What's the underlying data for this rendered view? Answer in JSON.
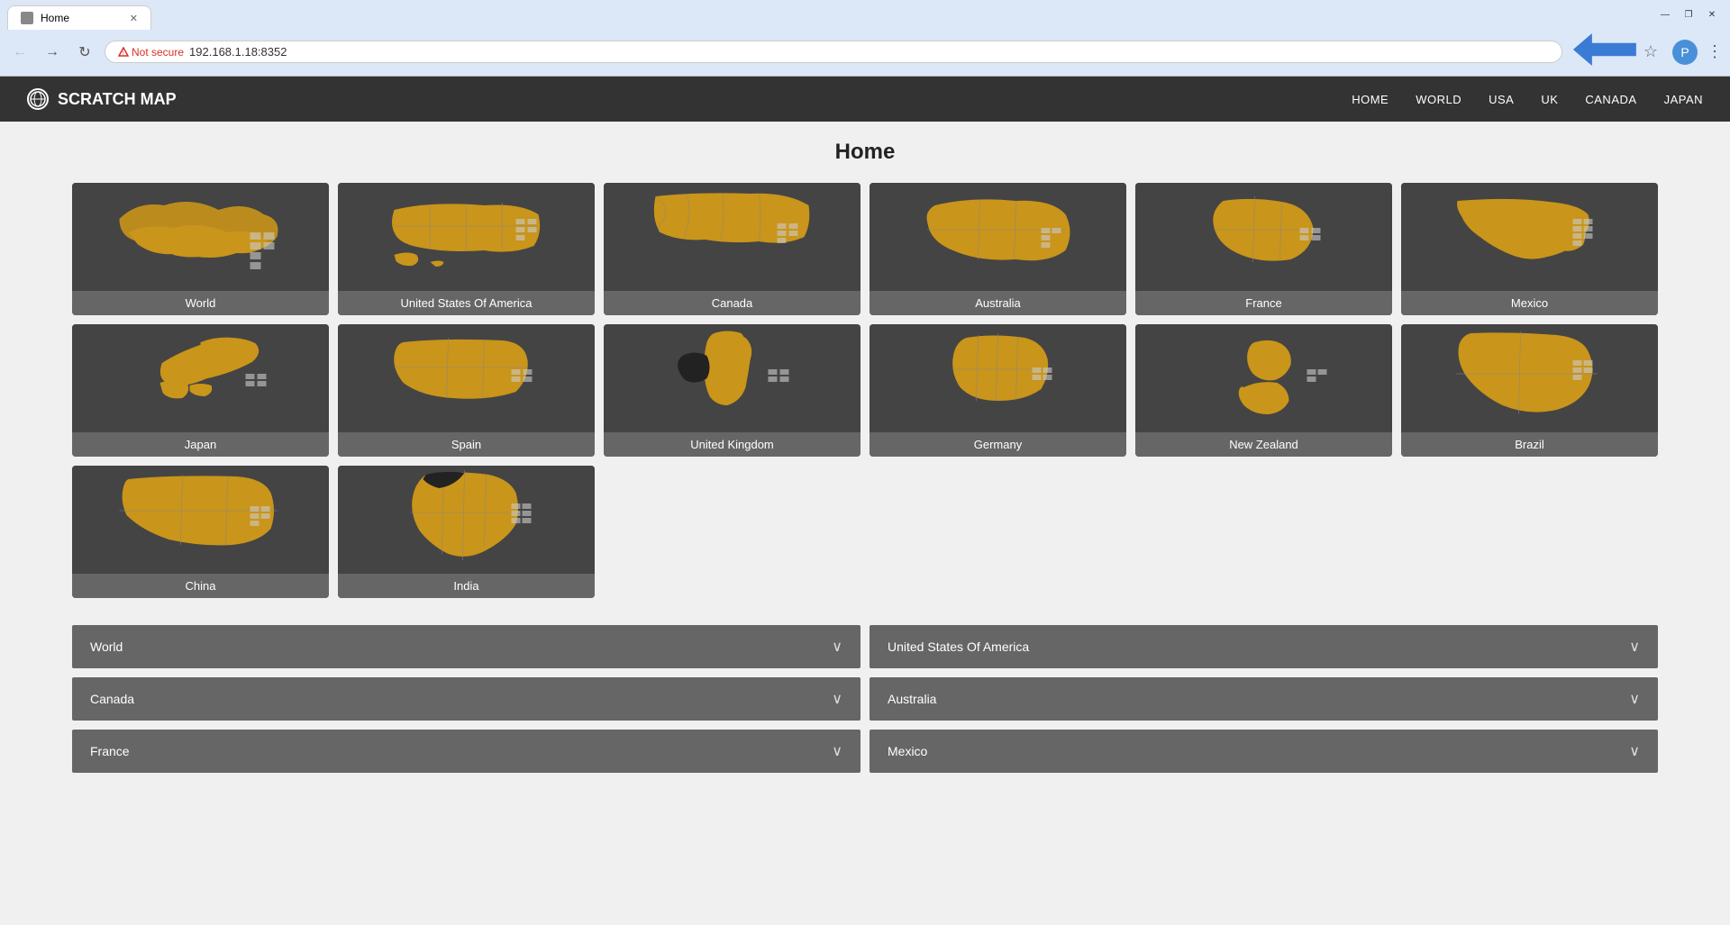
{
  "browser": {
    "tab_title": "Home",
    "url": "192.168.1.18:8352",
    "not_secure_label": "Not secure",
    "window_controls": [
      "minimize",
      "restore",
      "close"
    ]
  },
  "navbar": {
    "brand": "SCRATCH MAP",
    "links": [
      "HOME",
      "WORLD",
      "USA",
      "UK",
      "CANADA",
      "JAPAN"
    ]
  },
  "page": {
    "title": "Home"
  },
  "maps": [
    {
      "id": "world",
      "label": "World"
    },
    {
      "id": "usa",
      "label": "United States Of America"
    },
    {
      "id": "canada",
      "label": "Canada"
    },
    {
      "id": "australia",
      "label": "Australia"
    },
    {
      "id": "france",
      "label": "France"
    },
    {
      "id": "mexico",
      "label": "Mexico"
    },
    {
      "id": "japan",
      "label": "Japan"
    },
    {
      "id": "spain",
      "label": "Spain"
    },
    {
      "id": "uk",
      "label": "United Kingdom"
    },
    {
      "id": "germany",
      "label": "Germany"
    },
    {
      "id": "newzealand",
      "label": "New Zealand"
    },
    {
      "id": "brazil",
      "label": "Brazil"
    },
    {
      "id": "china",
      "label": "China"
    },
    {
      "id": "india",
      "label": "India"
    }
  ],
  "accordion": {
    "items": [
      {
        "label": "World",
        "side": "left"
      },
      {
        "label": "United States Of America",
        "side": "right"
      },
      {
        "label": "Canada",
        "side": "left"
      },
      {
        "label": "Australia",
        "side": "right"
      },
      {
        "label": "France",
        "side": "left"
      },
      {
        "label": "Mexico",
        "side": "right"
      }
    ]
  },
  "colors": {
    "map_fill": "#c9951a",
    "map_bg": "#444444",
    "navbar_bg": "#333333",
    "label_bg": "#666666"
  }
}
